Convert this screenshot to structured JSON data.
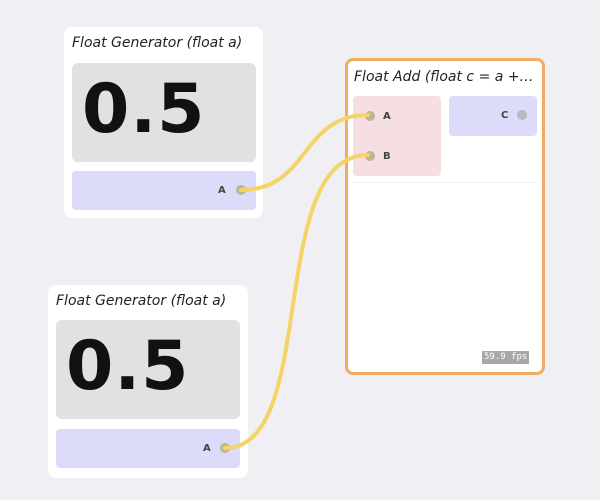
{
  "nodes": {
    "generator_top": {
      "title": "Float Generator (float a)",
      "value": "0.5",
      "output_port": "A"
    },
    "generator_bottom": {
      "title": "Float Generator (float a)",
      "value": "0.5",
      "output_port": "A"
    },
    "float_add": {
      "title": "Float Add (float c = a +…",
      "input_a": "A",
      "input_b": "B",
      "output_c": "C",
      "fps": "59.9 fps"
    }
  },
  "colors": {
    "canvas": "#f0f0f4",
    "node_bg": "#ffffff",
    "selected_border": "#f2ab63",
    "port_row": "#dcdcfa",
    "input_box": "#f6dfe3",
    "wire": "#f4d467"
  }
}
